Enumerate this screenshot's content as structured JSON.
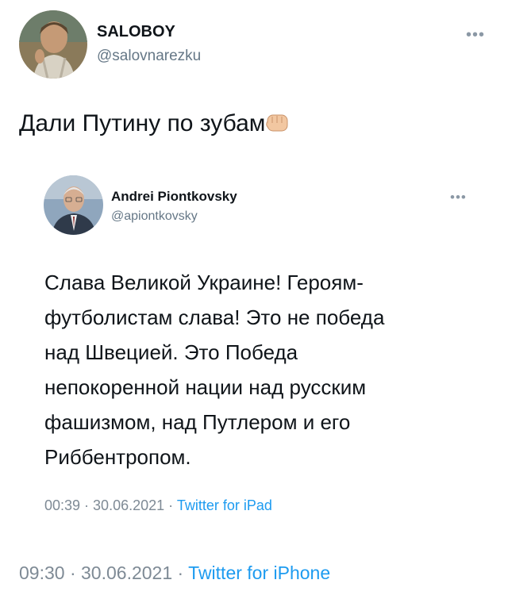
{
  "outer_tweet": {
    "author_name": "SALOBOY",
    "handle": "@salovnarezku",
    "text": "Дали Путину по зубам",
    "emoji_icon": "fist-bump-icon",
    "time": "09:30",
    "date": "30.06.2021",
    "source": "Twitter for iPhone"
  },
  "quoted_tweet": {
    "author_name": "Andrei Piontkovsky",
    "handle": "@apiontkovsky",
    "text_lines": [
      "Слава Великой Украине! Героям-",
      "футболистам слава! Это не победа",
      "над Швецией. Это Победа",
      "непокоренной нации над русским",
      "фашизмом, над Путлером и его",
      "Риббентропом."
    ],
    "time": "00:39",
    "date": "30.06.2021",
    "source": "Twitter for iPad"
  },
  "more_icon": "•••",
  "separator": " · ",
  "colors": {
    "link": "#1d9bf0",
    "muted": "#7e8a95"
  }
}
